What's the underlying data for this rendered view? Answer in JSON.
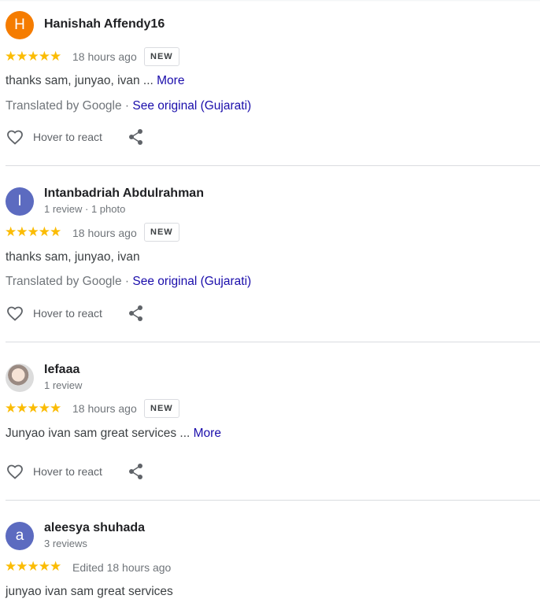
{
  "reviews": [
    {
      "name": "Hanishah Affendy16",
      "avatar_letter": "H",
      "avatar_color": "#f57c00",
      "meta": "",
      "stars": "★★★★★",
      "rating": 5,
      "time": "18 hours ago",
      "badge": "NEW",
      "text": "thanks sam, junyao, ivan ...",
      "more": "More",
      "translated_by": "Translated by Google · ",
      "see_original": "See original (Gujarati)",
      "react_label": "Hover to react"
    },
    {
      "name": "Intanbadriah Abdulrahman",
      "avatar_letter": "I",
      "avatar_color": "#5c6bc0",
      "meta": "1 review · 1 photo",
      "stars": "★★★★★",
      "rating": 5,
      "time": "18 hours ago",
      "badge": "NEW",
      "text": "thanks sam, junyao, ivan",
      "translated_by": "Translated by Google · ",
      "see_original": "See original (Gujarati)",
      "react_label": "Hover to react"
    },
    {
      "name": "Iefaaa",
      "avatar_icon": "profile-photo",
      "meta": "1 review",
      "stars": "★★★★★",
      "rating": 5,
      "time": "18 hours ago",
      "badge": "NEW",
      "text": "Junyao ivan sam great services ...",
      "more": "More",
      "react_label": "Hover to react"
    },
    {
      "name": "aleesya shuhada",
      "avatar_letter": "a",
      "avatar_color": "#5c6bc0",
      "meta": "3 reviews",
      "stars": "★★★★★",
      "rating": 5,
      "time": "Edited 18 hours ago",
      "text": "junyao ivan sam great services"
    }
  ],
  "colors": {
    "star": "#fbbc04",
    "link": "#1a0dab",
    "divider": "#dadce0"
  }
}
